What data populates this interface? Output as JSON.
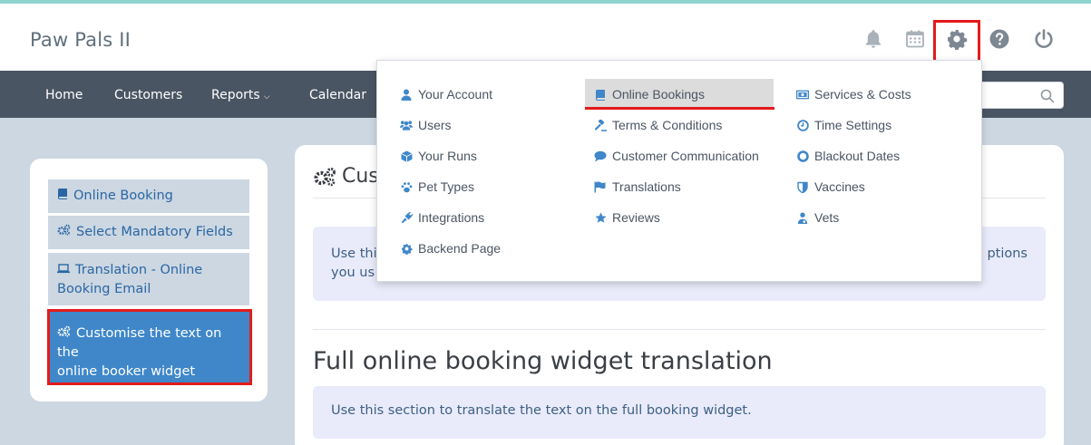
{
  "app": {
    "title": "Paw Pals II"
  },
  "header_icons": [
    "bell-icon",
    "calendar-icon",
    "gear-icon",
    "help-icon",
    "power-icon"
  ],
  "colors": {
    "accent": "#3f87c9",
    "nav_bg": "#4a5563",
    "page_bg": "#ccd7e2",
    "highlight_red": "#e31b1b",
    "info_box_bg": "#e9ebfb",
    "link_blue": "#2a66a3"
  },
  "nav": {
    "items": [
      {
        "label": "Home"
      },
      {
        "label": "Customers"
      },
      {
        "label": "Reports",
        "has_dropdown": true
      },
      {
        "label": "Calendar"
      }
    ],
    "search_placeholder": ""
  },
  "dropdown": {
    "columns": [
      [
        {
          "label": "Your Account",
          "icon": "user-icon"
        },
        {
          "label": "Users",
          "icon": "users-icon"
        },
        {
          "label": "Your Runs",
          "icon": "cube-icon"
        },
        {
          "label": "Pet Types",
          "icon": "paw-icon"
        },
        {
          "label": "Integrations",
          "icon": "plug-icon"
        },
        {
          "label": "Backend Page",
          "icon": "gear-icon"
        }
      ],
      [
        {
          "label": "Online Bookings",
          "icon": "book-icon",
          "selected": true
        },
        {
          "label": "Terms & Conditions",
          "icon": "gavel-icon"
        },
        {
          "label": "Customer Communication",
          "icon": "comment-icon"
        },
        {
          "label": "Translations",
          "icon": "flag-icon"
        },
        {
          "label": "Reviews",
          "icon": "star-icon"
        }
      ],
      [
        {
          "label": "Services & Costs",
          "icon": "money-icon"
        },
        {
          "label": "Time Settings",
          "icon": "clock-icon"
        },
        {
          "label": "Blackout Dates",
          "icon": "circle-dot-icon"
        },
        {
          "label": "Vaccines",
          "icon": "shield-icon"
        },
        {
          "label": "Vets",
          "icon": "doctor-icon"
        }
      ]
    ]
  },
  "sidebar": {
    "items": [
      {
        "label": "Online Booking",
        "icon": "book-icon"
      },
      {
        "label": "Select Mandatory Fields",
        "icon": "cogs-icon"
      },
      {
        "label_line1": "Translation - Online",
        "label_line2": "Booking Email",
        "icon": "laptop-icon"
      },
      {
        "label_line1": "Customise the text on the",
        "label_line2": "online booker widget",
        "icon": "cogs-icon",
        "active": true
      }
    ]
  },
  "main": {
    "heading_partial": "Cus",
    "info1_line1_partial": "Use thi",
    "info1_line2_partial": "you us",
    "info1_right_partial": "ptions",
    "section_title": "Full online booking widget translation",
    "info2": "Use this section to translate the text on the full booking widget."
  }
}
